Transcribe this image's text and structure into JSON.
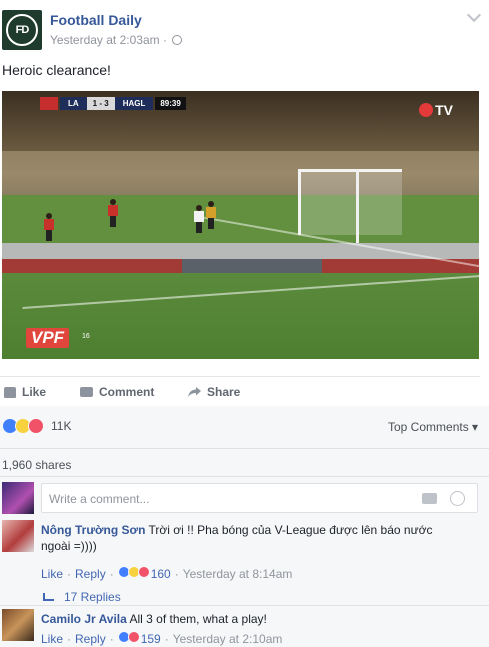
{
  "post": {
    "page_name": "Football Daily",
    "avatar_initials": "FD",
    "timestamp": "Yesterday at 2:03am",
    "text": "Heroic clearance!"
  },
  "video": {
    "score_team_home": "LA",
    "score_value": "1 - 3",
    "score_team_away": "HAGL",
    "score_clock": "89:39",
    "broadcaster_logo": "TV",
    "league_logo": "VPF",
    "league_logo_sub": "16"
  },
  "actions": {
    "like_label": "Like",
    "comment_label": "Comment",
    "share_label": "Share"
  },
  "feedback": {
    "reaction_count": "11K",
    "reaction_icons": [
      "like",
      "wow",
      "love"
    ],
    "sort_label": "Top Comments",
    "shares_label": "1,960 shares",
    "composer_placeholder": "Write a comment..."
  },
  "comments": [
    {
      "author": "Nông Trường Sơn",
      "text": "Trời ơi !! Pha bóng của V-League được lên báo nước ngoài =))))",
      "like": "Like",
      "reply": "Reply",
      "reaction_icons": [
        "like",
        "haha",
        "love"
      ],
      "reaction_count": "160",
      "time": "Yesterday at 8:14am",
      "replies_label": "17 Replies"
    },
    {
      "author": "Camilo Jr Avila",
      "text": "All 3 of them, what a play!",
      "like": "Like",
      "reply": "Reply",
      "reaction_icons": [
        "like",
        "love"
      ],
      "reaction_count": "159",
      "time": "Yesterday at 2:10am"
    }
  ],
  "colors": {
    "link_blue": "#365899",
    "meta_gray": "#90949c",
    "feedback_bg": "#f6f7f9"
  }
}
